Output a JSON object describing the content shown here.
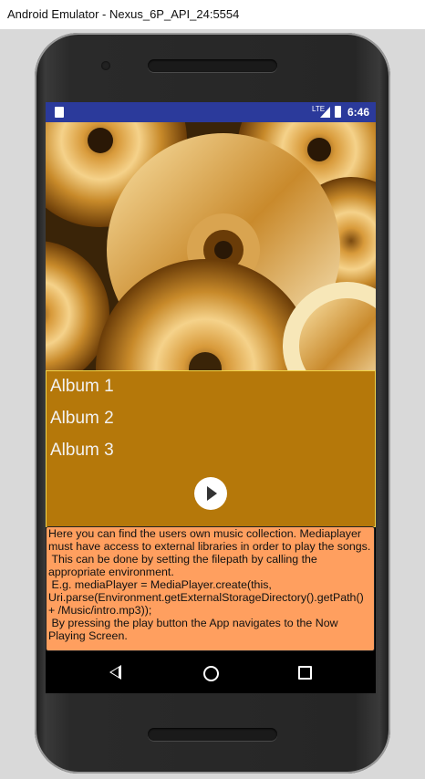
{
  "window": {
    "title": "Android Emulator - Nexus_6P_API_24:5554"
  },
  "statusbar": {
    "network_label": "LTE",
    "time": "6:46"
  },
  "albums": [
    {
      "label": "Album 1"
    },
    {
      "label": "Album 2"
    },
    {
      "label": "Album 3"
    }
  ],
  "info_text": "Here you can find the users own music collection. Mediaplayer must have access to external libraries in order to play the songs.\n This can be done by setting the filepath by calling the appropriate environment.\n E.g. mediaPlayer = MediaPlayer.create(this, Uri.parse(Environment.getExternalStorageDirectory().getPath() + /Music/intro.mp3));\n By pressing the play button the App navigates to the Now Playing Screen.",
  "colors": {
    "statusbar": "#2b3a9b",
    "album_panel": "#b5780a",
    "info_box": "#ff9f5f"
  }
}
